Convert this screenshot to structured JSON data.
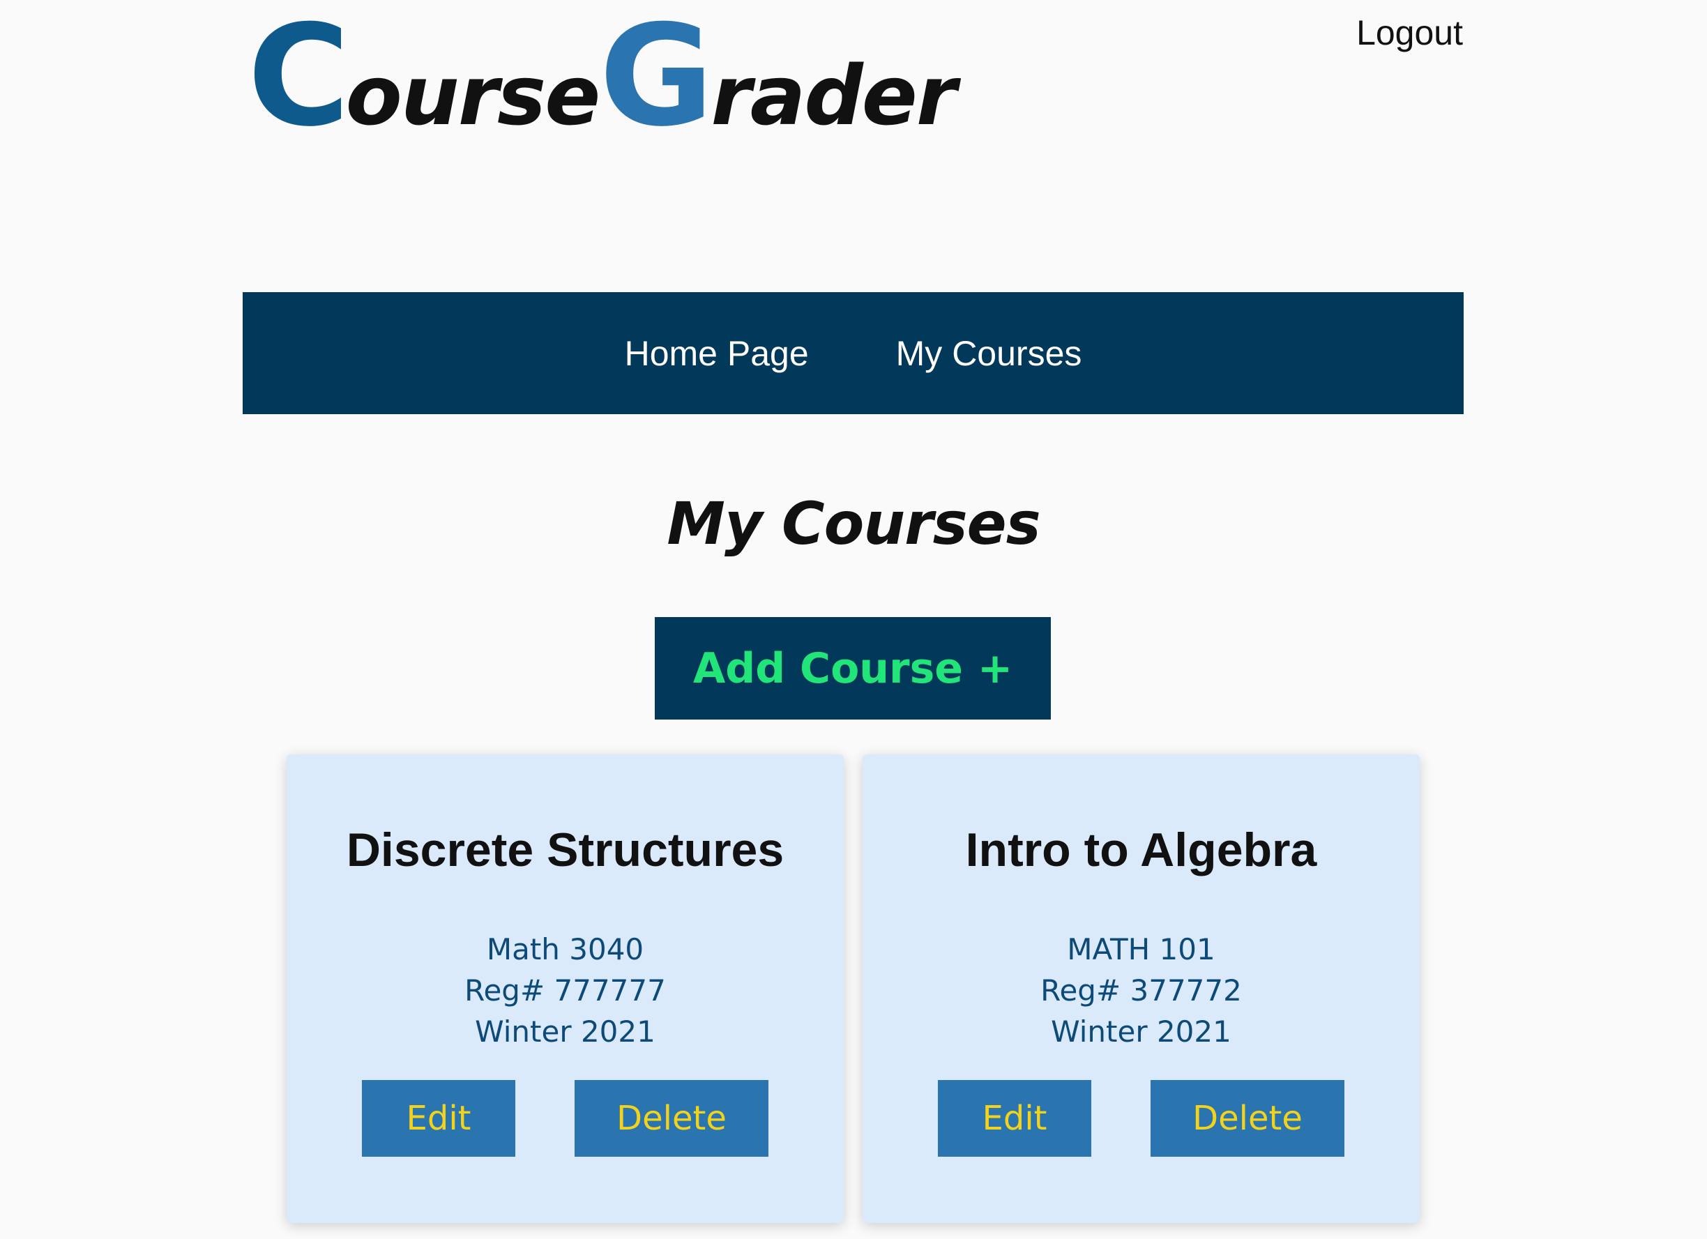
{
  "header": {
    "logo": {
      "first_cap": "C",
      "first_rest": "ourse",
      "second_cap": "G",
      "second_rest": "rader"
    },
    "logout_label": "Logout"
  },
  "nav": {
    "items": [
      {
        "label": "Home Page"
      },
      {
        "label": "My Courses"
      }
    ]
  },
  "main": {
    "title": "My Courses",
    "add_course_label": "Add Course +"
  },
  "courses": [
    {
      "title": "Discrete Structures",
      "code": "Math 3040",
      "reg": "Reg# 777777",
      "term": "Winter 2021",
      "edit_label": "Edit",
      "delete_label": "Delete"
    },
    {
      "title": "Intro to Algebra",
      "code": "MATH 101",
      "reg": "Reg# 377772",
      "term": "Winter 2021",
      "edit_label": "Edit",
      "delete_label": "Delete"
    }
  ],
  "colors": {
    "nav_bg": "#023859",
    "logo_c": "#0f5a8c",
    "logo_g": "#2a75b0",
    "add_text": "#22e57a",
    "card_bg": "#dbeafb",
    "button_bg": "#2a75b0",
    "button_text": "#f3d21c",
    "card_info_text": "#0d4a78"
  }
}
